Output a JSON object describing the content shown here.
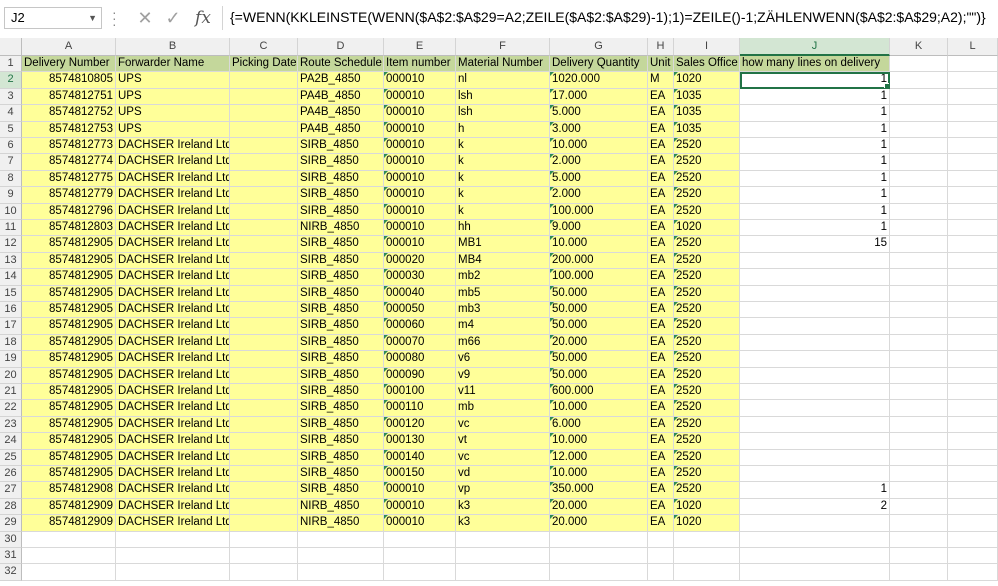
{
  "formula_bar": {
    "name_box": "J2",
    "formula": "{=WENN(KKLEINSTE(WENN($A$2:$A$29=A2;ZEILE($A$2:$A$29)-1);1)=ZEILE()-1;ZÄHLENWENN($A$2:$A$29;A2);\"\")}"
  },
  "columns": [
    "A",
    "B",
    "C",
    "D",
    "E",
    "F",
    "G",
    "H",
    "I",
    "J",
    "K",
    "L"
  ],
  "headers": [
    "Delivery Number",
    "Forwarder Name",
    "Picking Date",
    "Route Schedule",
    "Item number",
    "Material Number",
    "Delivery Quantity",
    "Unit",
    "Sales Office",
    "how many lines on delivery"
  ],
  "rows": [
    [
      "8574810805",
      "UPS",
      "",
      "PA2B_4850",
      "000010",
      "nl",
      "1020.000",
      "M",
      "1020",
      "1"
    ],
    [
      "8574812751",
      "UPS",
      "",
      "PA4B_4850",
      "000010",
      "lsh",
      "17.000",
      "EA",
      "1035",
      "1"
    ],
    [
      "8574812752",
      "UPS",
      "",
      "PA4B_4850",
      "000010",
      "lsh",
      "5.000",
      "EA",
      "1035",
      "1"
    ],
    [
      "8574812753",
      "UPS",
      "",
      "PA4B_4850",
      "000010",
      "h",
      "3.000",
      "EA",
      "1035",
      "1"
    ],
    [
      "8574812773",
      "DACHSER Ireland Ltd.",
      "",
      "SIRB_4850",
      "000010",
      "k",
      "10.000",
      "EA",
      "2520",
      "1"
    ],
    [
      "8574812774",
      "DACHSER Ireland Ltd.",
      "",
      "SIRB_4850",
      "000010",
      "k",
      "2.000",
      "EA",
      "2520",
      "1"
    ],
    [
      "8574812775",
      "DACHSER Ireland Ltd.",
      "",
      "SIRB_4850",
      "000010",
      "k",
      "5.000",
      "EA",
      "2520",
      "1"
    ],
    [
      "8574812779",
      "DACHSER Ireland Ltd.",
      "",
      "SIRB_4850",
      "000010",
      "k",
      "2.000",
      "EA",
      "2520",
      "1"
    ],
    [
      "8574812796",
      "DACHSER Ireland Ltd.",
      "",
      "SIRB_4850",
      "000010",
      "k",
      "100.000",
      "EA",
      "2520",
      "1"
    ],
    [
      "8574812803",
      "DACHSER Ireland Ltd.",
      "",
      "NIRB_4850",
      "000010",
      "hh",
      "9.000",
      "EA",
      "1020",
      "1"
    ],
    [
      "8574812905",
      "DACHSER Ireland Ltd.",
      "",
      "SIRB_4850",
      "000010",
      "MB1",
      "10.000",
      "EA",
      "2520",
      "15"
    ],
    [
      "8574812905",
      "DACHSER Ireland Ltd.",
      "",
      "SIRB_4850",
      "000020",
      "MB4",
      "200.000",
      "EA",
      "2520",
      ""
    ],
    [
      "8574812905",
      "DACHSER Ireland Ltd.",
      "",
      "SIRB_4850",
      "000030",
      "mb2",
      "100.000",
      "EA",
      "2520",
      ""
    ],
    [
      "8574812905",
      "DACHSER Ireland Ltd.",
      "",
      "SIRB_4850",
      "000040",
      "mb5",
      "50.000",
      "EA",
      "2520",
      ""
    ],
    [
      "8574812905",
      "DACHSER Ireland Ltd.",
      "",
      "SIRB_4850",
      "000050",
      "mb3",
      "50.000",
      "EA",
      "2520",
      ""
    ],
    [
      "8574812905",
      "DACHSER Ireland Ltd.",
      "",
      "SIRB_4850",
      "000060",
      "m4",
      "50.000",
      "EA",
      "2520",
      ""
    ],
    [
      "8574812905",
      "DACHSER Ireland Ltd.",
      "",
      "SIRB_4850",
      "000070",
      "m66",
      "20.000",
      "EA",
      "2520",
      ""
    ],
    [
      "8574812905",
      "DACHSER Ireland Ltd.",
      "",
      "SIRB_4850",
      "000080",
      "v6",
      "50.000",
      "EA",
      "2520",
      ""
    ],
    [
      "8574812905",
      "DACHSER Ireland Ltd.",
      "",
      "SIRB_4850",
      "000090",
      "v9",
      "50.000",
      "EA",
      "2520",
      ""
    ],
    [
      "8574812905",
      "DACHSER Ireland Ltd.",
      "",
      "SIRB_4850",
      "000100",
      "v11",
      "600.000",
      "EA",
      "2520",
      ""
    ],
    [
      "8574812905",
      "DACHSER Ireland Ltd.",
      "",
      "SIRB_4850",
      "000110",
      "mb",
      "10.000",
      "EA",
      "2520",
      ""
    ],
    [
      "8574812905",
      "DACHSER Ireland Ltd.",
      "",
      "SIRB_4850",
      "000120",
      "vc",
      "6.000",
      "EA",
      "2520",
      ""
    ],
    [
      "8574812905",
      "DACHSER Ireland Ltd.",
      "",
      "SIRB_4850",
      "000130",
      "vt",
      "10.000",
      "EA",
      "2520",
      ""
    ],
    [
      "8574812905",
      "DACHSER Ireland Ltd.",
      "",
      "SIRB_4850",
      "000140",
      "vc",
      "12.000",
      "EA",
      "2520",
      ""
    ],
    [
      "8574812905",
      "DACHSER Ireland Ltd.",
      "",
      "SIRB_4850",
      "000150",
      "vd",
      "10.000",
      "EA",
      "2520",
      ""
    ],
    [
      "8574812908",
      "DACHSER Ireland Ltd.",
      "",
      "SIRB_4850",
      "000010",
      "vp",
      "350.000",
      "EA",
      "2520",
      "1"
    ],
    [
      "8574812909",
      "DACHSER Ireland Ltd.",
      "",
      "NIRB_4850",
      "000010",
      "k3",
      "20.000",
      "EA",
      "1020",
      "2"
    ],
    [
      "8574812909",
      "DACHSER Ireland Ltd.",
      "",
      "NIRB_4850",
      "000010",
      "k3",
      "20.000",
      "EA",
      "1020",
      ""
    ]
  ],
  "row_numbers": [
    "1",
    "2",
    "3",
    "4",
    "5",
    "6",
    "7",
    "8",
    "9",
    "10",
    "11",
    "12",
    "13",
    "14",
    "15",
    "16",
    "17",
    "18",
    "19",
    "20",
    "21",
    "22",
    "23",
    "24",
    "25",
    "26",
    "27",
    "28",
    "29",
    "30",
    "31",
    "32"
  ],
  "colors": {
    "data_fill": "#ffff99",
    "header_fill": "#c4d79b",
    "accent": "#217346"
  }
}
